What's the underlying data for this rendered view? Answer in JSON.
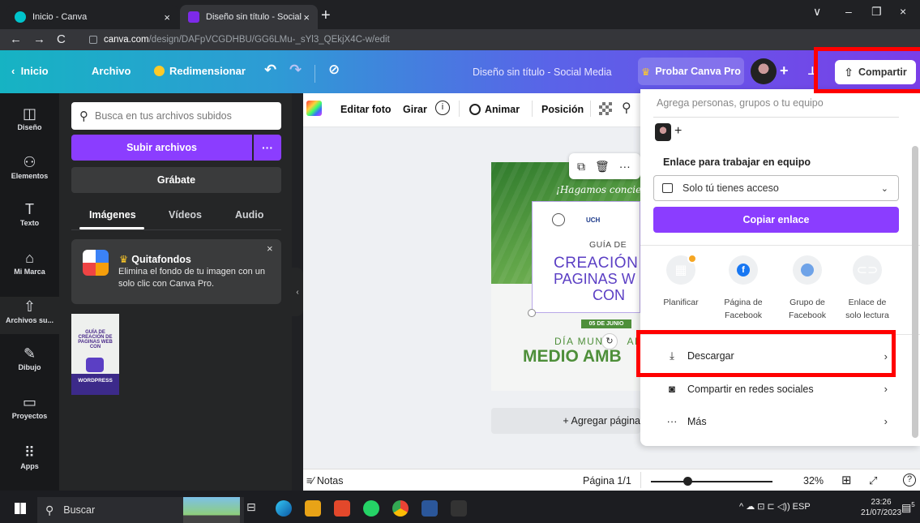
{
  "browser": {
    "tabs": [
      {
        "title": "Inicio - Canva",
        "close": "×"
      },
      {
        "title": "Diseño sin título - Social Media",
        "close": "×"
      }
    ],
    "new_tab": "+",
    "window_controls": [
      "∨",
      "–",
      "❐",
      "×"
    ],
    "url_host": "canva.com",
    "url_path": "/design/DAFpVCGDHBU/GG6LMu-_sYl3_QEkjX4C-w/edit"
  },
  "header": {
    "home": "Inicio",
    "file": "Archivo",
    "resize": "Redimensionar",
    "doc_title": "Diseño sin título - Social Media",
    "try_pro": "Probar Canva Pro",
    "share": "Compartir"
  },
  "rail": [
    {
      "label": "Diseño",
      "icon": "layout-icon",
      "glyph": "◫"
    },
    {
      "label": "Elementos",
      "icon": "elements-icon",
      "glyph": "⚇"
    },
    {
      "label": "Texto",
      "icon": "text-icon",
      "glyph": "T"
    },
    {
      "label": "Mi Marca",
      "icon": "brand-icon",
      "glyph": "⌂"
    },
    {
      "label": "Archivos su...",
      "icon": "upload-icon",
      "glyph": "⇧"
    },
    {
      "label": "Dibujo",
      "icon": "draw-icon",
      "glyph": "✎"
    },
    {
      "label": "Proyectos",
      "icon": "folder-icon",
      "glyph": "▭"
    },
    {
      "label": "Apps",
      "icon": "apps-icon",
      "glyph": "⠿"
    }
  ],
  "panel": {
    "search_placeholder": "Busca en tus archivos subidos",
    "upload": "Subir archivos",
    "upload_more": "···",
    "record": "Grábate",
    "tabs": [
      "Imágenes",
      "Vídeos",
      "Audio"
    ],
    "promo": {
      "title": "Quitafondos",
      "desc": "Elimina el fondo de tu imagen con un solo clic con Canva Pro.",
      "close": "×"
    },
    "thumb_title": "GUÍA DE CREACIÓN DE PAGINAS WEB CON",
    "thumb_wp": "WORDPRESS"
  },
  "toolbar": {
    "edit_photo": "Editar foto",
    "rotate": "Girar",
    "info": "i",
    "animate": "Animar",
    "position": "Posición"
  },
  "design": {
    "banner": "¡Hagamos concien",
    "guia": "GUÍA DE",
    "creacion": "CREACIÓN",
    "paginas": "PAGINAS W",
    "con": "CON",
    "fecha": "05 DE JUNIO",
    "dia": "DÍA MUN",
    "dia_end": "AL",
    "medio": "MEDIO AMB",
    "logo2": "UCH"
  },
  "add_page": "+ Agregar página",
  "share_panel": {
    "invite_placeholder": "Agrega personas, grupos o tu equipo",
    "link_heading": "Enlace para trabajar en equipo",
    "access": "Solo tú tienes acceso",
    "copy": "Copiar enlace",
    "options": [
      {
        "label": "Planificar",
        "icon": "calendar-icon"
      },
      {
        "label": "Página de Facebook",
        "icon": "facebook-icon"
      },
      {
        "label": "Grupo de Facebook",
        "icon": "facebook-group-icon"
      },
      {
        "label": "Enlace de solo lectura",
        "icon": "link-icon"
      }
    ],
    "menu": [
      {
        "label": "Descargar",
        "icon": "download-icon"
      },
      {
        "label": "Compartir en redes sociales",
        "icon": "social-icon"
      },
      {
        "label": "Más",
        "icon": "more-icon"
      }
    ]
  },
  "bottom": {
    "notes": "Notas",
    "page": "Página 1/1",
    "zoom": "32%",
    "zoom_level": 0.3
  },
  "taskbar": {
    "search": "Buscar",
    "lang": "ESP",
    "time": "23:26",
    "date": "21/07/2023",
    "notif_count": "5"
  },
  "colors": {
    "canva_purple": "#8b3dff",
    "annotation_red": "#ff0000",
    "design_green": "#4e8f3a",
    "design_purple": "#5b3fc4"
  }
}
